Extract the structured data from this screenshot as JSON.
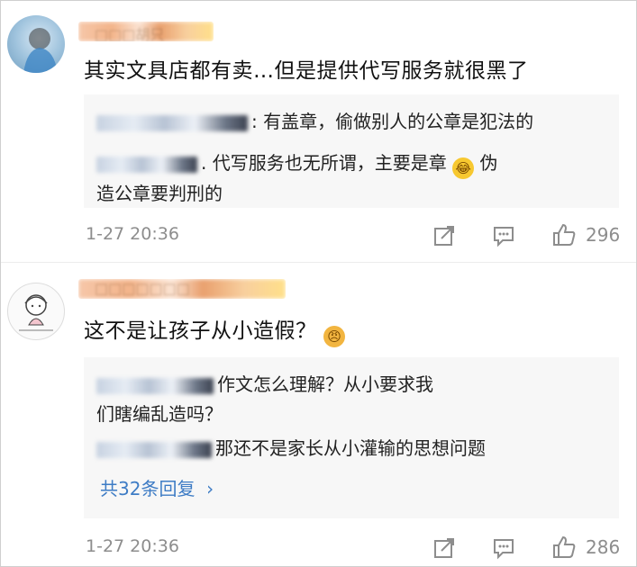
{
  "comments": [
    {
      "username": "□□□胡只",
      "text": "其实文具店都有卖…但是提供代写服务就很黑了",
      "replies": [
        {
          "name": "□□□□□无花",
          "text": ": 有盖章，偷做别人的公章是犯法的"
        },
        {
          "name": "□□□□□",
          "text": ". 代写服务也无所谓，主要是章",
          "emoji": "laughing-tears-emoji",
          "after": " 伪造公章要判刑的"
        }
      ],
      "time": "1-27 20:36",
      "likes": "296"
    },
    {
      "username": "□□□□□□□",
      "text": "这不是让孩子从小造假？",
      "emoji": "angry-emoji",
      "replies": [
        {
          "name": "□□□□□□",
          "text": "作文怎么理解？从小要求我们瞎编乱造吗？"
        },
        {
          "name": "□□□□□",
          "text": "那还不是家长从小灌输的思想问题"
        }
      ],
      "more_replies": "共32条回复",
      "time": "1-27 20:36",
      "likes": "286"
    }
  ],
  "colors": {
    "link": "#3e7cc5",
    "meta": "#8d8d8d",
    "reply_bg": "#f7f7f7"
  }
}
